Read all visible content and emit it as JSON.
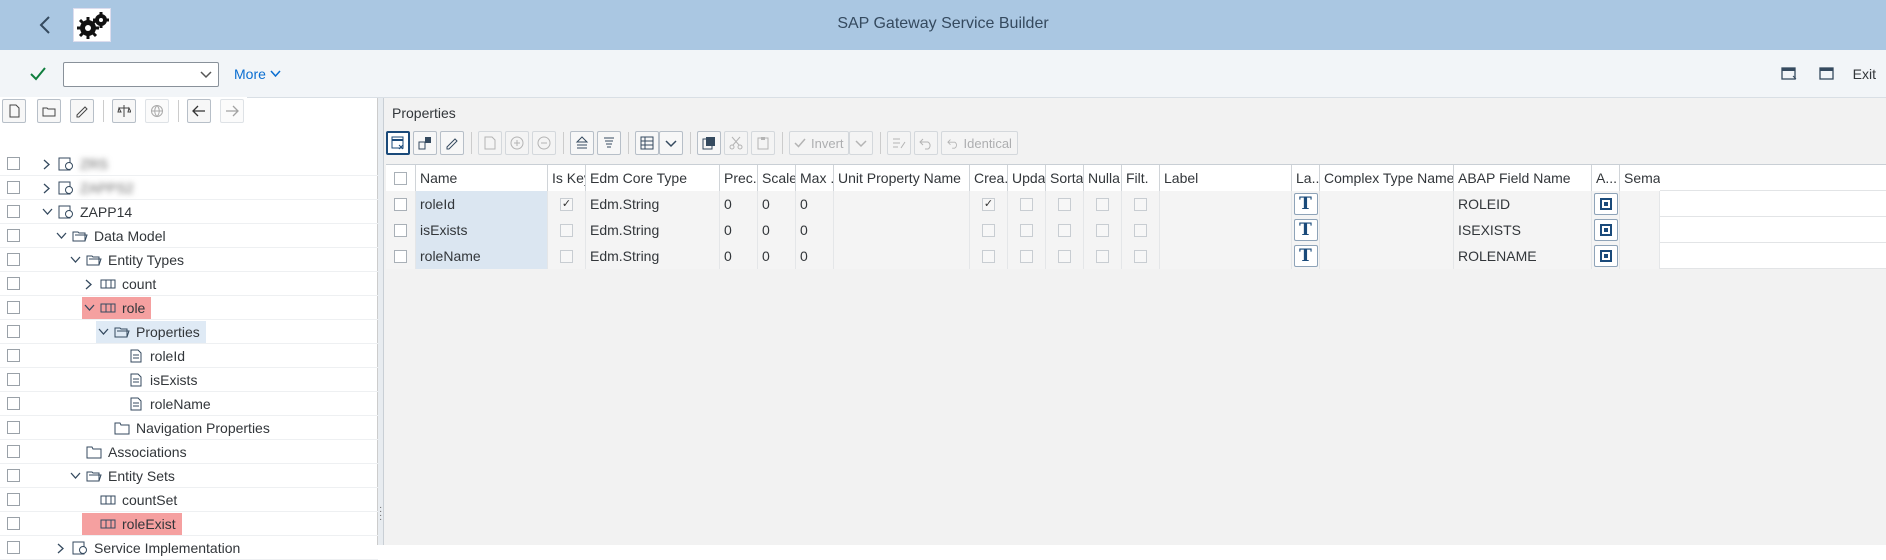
{
  "app": {
    "title": "SAP Gateway Service Builder"
  },
  "toolbar": {
    "command_value": "",
    "more_label": "More",
    "exit_label": "Exit"
  },
  "tree": {
    "items": [
      {
        "label": "ZRS",
        "level": 0,
        "blurred": true
      },
      {
        "label": "ZAPPS2",
        "level": 0,
        "blurred": true
      },
      {
        "label": "ZAPP14",
        "level": 0
      },
      {
        "label": "Data Model",
        "level": 1
      },
      {
        "label": "Entity Types",
        "level": 2
      },
      {
        "label": "count",
        "level": 3
      },
      {
        "label": "role",
        "level": 3,
        "highlight": "red"
      },
      {
        "label": "Properties",
        "level": 4,
        "highlight": "blue"
      },
      {
        "label": "roleId",
        "level": 5
      },
      {
        "label": "isExists",
        "level": 5
      },
      {
        "label": "roleName",
        "level": 5
      },
      {
        "label": "Navigation Properties",
        "level": 4
      },
      {
        "label": "Associations",
        "level": 2
      },
      {
        "label": "Entity Sets",
        "level": 2
      },
      {
        "label": "countSet",
        "level": 3
      },
      {
        "label": "roleExist",
        "level": 3,
        "highlight": "red"
      },
      {
        "label": "Service Implementation",
        "level": 1
      }
    ]
  },
  "properties": {
    "title": "Properties",
    "toolbar": {
      "invert_label": "Invert",
      "identical_label": "Identical"
    },
    "columns": [
      "Name",
      "Is Key",
      "Edm Core Type",
      "Prec.",
      "Scale",
      "Max ...",
      "Unit Property Name",
      "Crea...",
      "Upda...",
      "Sorta...",
      "Nulla...",
      "Filt.",
      "Label",
      "La...",
      "Complex Type Name",
      "ABAP Field Name",
      "A...",
      "Seman"
    ],
    "rows": [
      {
        "name": "roleId",
        "is_key": true,
        "edm_type": "Edm.String",
        "prec": "0",
        "scale": "0",
        "max": "0",
        "unit": "",
        "creatable": true,
        "updatable": false,
        "sortable": false,
        "nullable": false,
        "filterable": false,
        "label": "",
        "complex_type": "",
        "abap_field": "ROLEID"
      },
      {
        "name": "isExists",
        "is_key": false,
        "edm_type": "Edm.String",
        "prec": "0",
        "scale": "0",
        "max": "0",
        "unit": "",
        "creatable": false,
        "updatable": false,
        "sortable": false,
        "nullable": false,
        "filterable": false,
        "label": "",
        "complex_type": "",
        "abap_field": "ISEXISTS"
      },
      {
        "name": "roleName",
        "is_key": false,
        "edm_type": "Edm.String",
        "prec": "0",
        "scale": "0",
        "max": "0",
        "unit": "",
        "creatable": false,
        "updatable": false,
        "sortable": false,
        "nullable": false,
        "filterable": false,
        "label": "",
        "complex_type": "",
        "abap_field": "ROLENAME"
      }
    ]
  }
}
